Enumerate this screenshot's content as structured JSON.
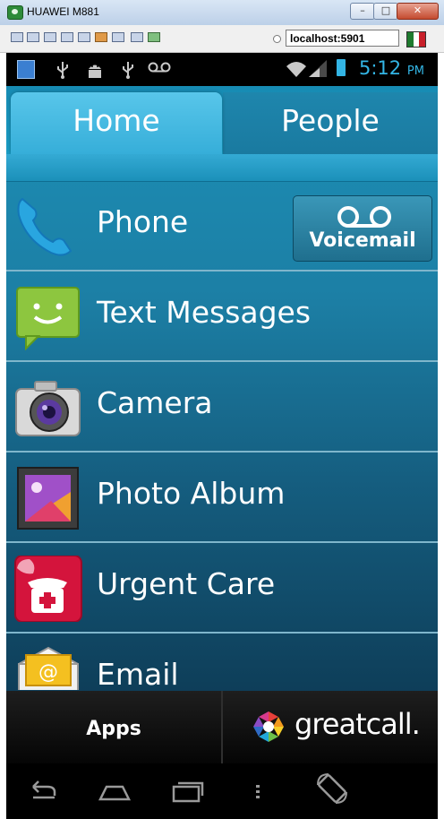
{
  "window": {
    "title": "HUAWEI M881",
    "minimize": "–",
    "maximize": "□",
    "close": "✕"
  },
  "toolbar": {
    "address": "localhost:5901"
  },
  "status_bar": {
    "time": "5:12",
    "ampm": "PM",
    "accent_color": "#33b5e5"
  },
  "tabs": [
    {
      "label": "Home"
    },
    {
      "label": "People"
    }
  ],
  "list_items": [
    {
      "label": "Phone",
      "icon": "phone-handset-icon"
    },
    {
      "label": "Text Messages",
      "icon": "chat-bubble-smiley-icon"
    },
    {
      "label": "Camera",
      "icon": "camera-icon"
    },
    {
      "label": "Photo Album",
      "icon": "photo-frame-icon"
    },
    {
      "label": "Urgent Care",
      "icon": "urgent-care-telephone-icon"
    },
    {
      "label": "Email",
      "icon": "email-envelope-icon"
    }
  ],
  "voicemail": {
    "label": "Voicemail",
    "icon": "voicemail-icon"
  },
  "bottom_bar": {
    "apps_label": "Apps",
    "brand_label": "greatcall."
  },
  "navigation": [
    "back-icon",
    "home-icon",
    "recent-apps-icon",
    "menu-icon",
    "rotate-icon"
  ]
}
